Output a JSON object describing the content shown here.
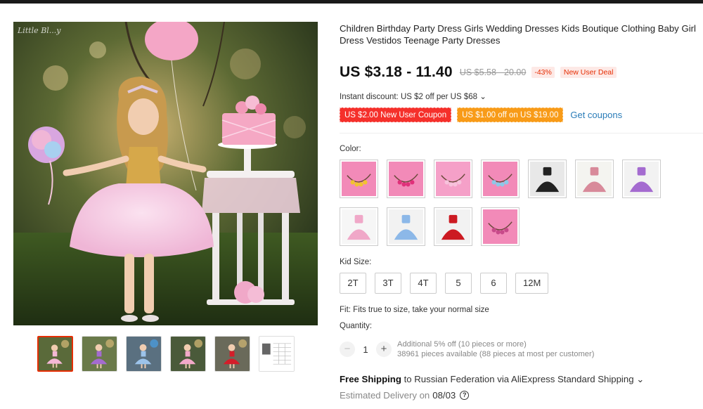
{
  "product": {
    "watermark": "Little Bl...y",
    "title": "Children Birthday Party Dress Girls Wedding Dresses Kids Boutique Clothing Baby Girl Dress Vestidos Teenage Party Dresses",
    "price": "US $3.18 - 11.40",
    "old_price": "US $5.58 - 20.00",
    "discount": "-43%",
    "deal_badge": "New User Deal",
    "instant_discount": "Instant discount: US $2 off per US $68 ⌄",
    "coupons": [
      "US $2.00 New User Coupon",
      "US $1.00 off on US $19.00"
    ],
    "get_coupons": "Get coupons"
  },
  "thumbnails": [
    {
      "name": "pink dress",
      "dress_color": "#f4b8d6",
      "bg": "#5a6a3a"
    },
    {
      "name": "purple dress",
      "dress_color": "#a46bd0",
      "bg": "#6a7a4a"
    },
    {
      "name": "blue dress",
      "dress_color": "#9cc3ea",
      "bg": "#5a7080"
    },
    {
      "name": "pink dress 2",
      "dress_color": "#f2a9c9",
      "bg": "#4a5a3a"
    },
    {
      "name": "red dress",
      "dress_color": "#d41e2a",
      "bg": "#6a6a5a"
    },
    {
      "name": "size chart",
      "dress_color": "#dddddd",
      "bg": "#ffffff"
    }
  ],
  "color_label": "Color:",
  "colors": [
    {
      "name": "headband yellow flowers",
      "type": "headband",
      "bg": "#f28ab8",
      "accent": "#f2c230"
    },
    {
      "name": "headband pink flowers",
      "type": "headband",
      "bg": "#f28ab8",
      "accent": "#e0307a"
    },
    {
      "name": "headband light pink flowers",
      "type": "headband",
      "bg": "#f5a0c8",
      "accent": "#f7c2dc"
    },
    {
      "name": "headband blue flowers",
      "type": "headband",
      "bg": "#f28ab8",
      "accent": "#8cc8e8"
    },
    {
      "name": "black dress",
      "type": "dress",
      "bg": "#e8e8e8",
      "accent": "#222222"
    },
    {
      "name": "floral white dress",
      "type": "dress",
      "bg": "#f4f4f0",
      "accent": "#d88a9a"
    },
    {
      "name": "purple dress",
      "type": "dress",
      "bg": "#f2f2f2",
      "accent": "#a46bd0"
    },
    {
      "name": "pink dress",
      "type": "dress",
      "bg": "#f6f6f6",
      "accent": "#f0a8c8"
    },
    {
      "name": "blue dress",
      "type": "dress",
      "bg": "#f2f2f2",
      "accent": "#8cb8e8"
    },
    {
      "name": "red dress",
      "type": "dress",
      "bg": "#f2f2f2",
      "accent": "#cc1a22"
    },
    {
      "name": "headband pink",
      "type": "headband",
      "bg": "#f28ab8",
      "accent": "#c84a8a"
    }
  ],
  "size_label": "Kid Size:",
  "sizes": [
    "2T",
    "3T",
    "4T",
    "5",
    "6",
    "12M"
  ],
  "fit": "Fit: Fits true to size, take your normal size",
  "quantity": {
    "label": "Quantity:",
    "minus": "−",
    "value": "1",
    "plus": "+",
    "additional": "Additional 5% off (10 pieces or more)",
    "available": "38961 pieces available (88 pieces at most per customer)"
  },
  "shipping": {
    "free": "Free Shipping",
    "rest": " to Russian Federation via AliExpress Standard Shipping ⌄",
    "estimated": "Estimated Delivery on",
    "date": "08/03",
    "help": "?"
  }
}
